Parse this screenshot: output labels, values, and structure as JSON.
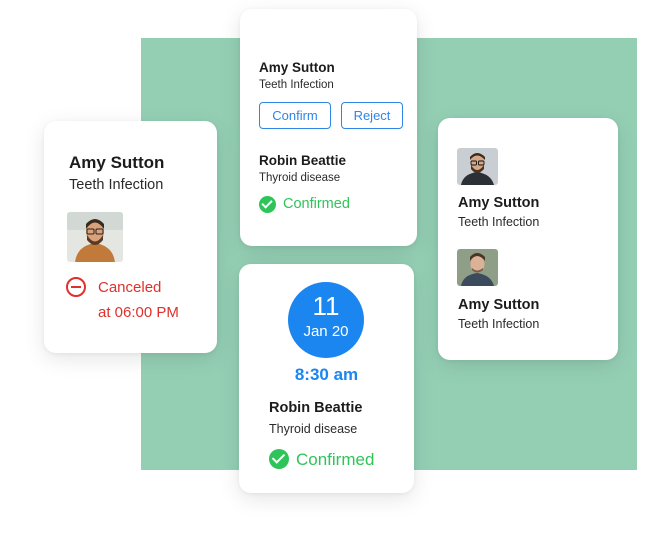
{
  "canceled_card": {
    "name": "Amy Sutton",
    "condition": "Teeth Infection",
    "status_line1": "Canceled",
    "status_line2": "at 06:00 PM",
    "status_color": "#e0302c"
  },
  "actions_card": {
    "patient1": {
      "name": "Amy Sutton",
      "condition": "Teeth Infection"
    },
    "confirm_label": "Confirm",
    "reject_label": "Reject",
    "patient2": {
      "name": "Robin Beattie",
      "condition": "Thyroid disease"
    },
    "status": "Confirmed"
  },
  "date_card": {
    "day": "11",
    "month": "Jan 20",
    "time": "8:30 am",
    "name": "Robin Beattie",
    "condition": "Thyroid disease",
    "status": "Confirmed"
  },
  "list_card": {
    "items": [
      {
        "name": "Amy Sutton",
        "condition": "Teeth Infection"
      },
      {
        "name": "Amy Sutton",
        "condition": "Teeth Infection"
      }
    ]
  },
  "colors": {
    "accent": "#1b86f0",
    "confirmed": "#2fc45a",
    "background_panel": "#94cfb4"
  }
}
